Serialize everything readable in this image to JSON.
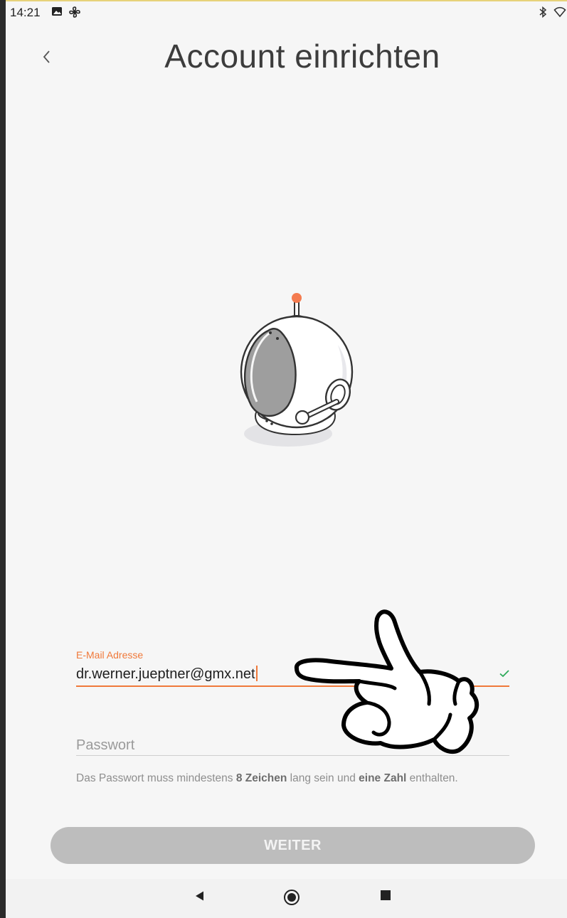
{
  "status_bar": {
    "time": "14:21",
    "left_icons": [
      "image-icon",
      "fan-icon"
    ],
    "right_icons": [
      "bluetooth-icon",
      "wifi-icon"
    ]
  },
  "header": {
    "title": "Account einrichten",
    "back_icon": "chevron-left-icon"
  },
  "illustration": {
    "name": "robot-camera",
    "accent_color": "#f47b4f"
  },
  "form": {
    "email": {
      "label": "E-Mail Adresse",
      "value": "dr.werner.jueptner@gmx.net",
      "valid": true,
      "status_icon": "check-icon"
    },
    "password": {
      "placeholder": "Passwort",
      "value": ""
    },
    "hint": {
      "part1": "Das Passwort muss mindestens ",
      "bold1": "8 Zeichen",
      "part2": " lang sein und ",
      "bold2": "eine Zahl",
      "part3": " enthalten."
    }
  },
  "primary_button": {
    "label": "WEITER",
    "enabled": false
  },
  "nav_bar": {
    "buttons": [
      "back-triangle-icon",
      "home-circle-icon",
      "recents-square-icon"
    ]
  },
  "overlay": {
    "type": "pointing-hand-drawing",
    "points_to": "email-field"
  },
  "colors": {
    "accent": "#f0793a",
    "valid": "#2eaa5a",
    "button_disabled": "#bdbdbd",
    "background": "#f6f6f6"
  }
}
